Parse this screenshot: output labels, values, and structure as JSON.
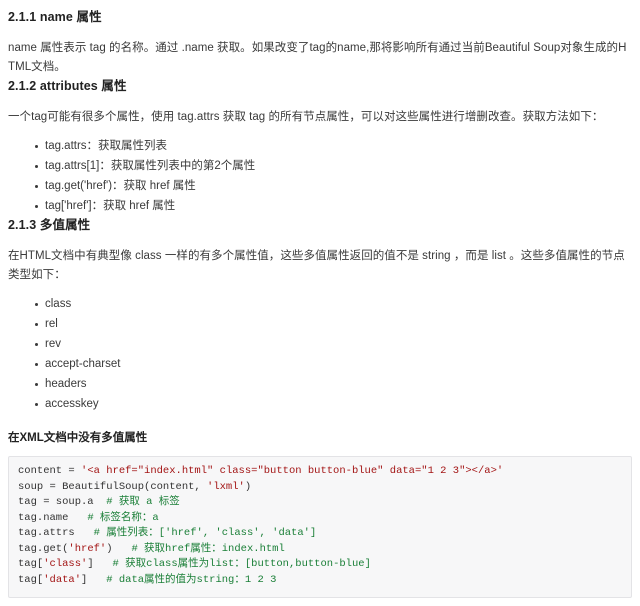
{
  "document": {
    "sections": [
      {
        "id": "2.1.1",
        "heading": "2.1.1 name 属性",
        "paragraph": "name 属性表示 tag 的名称。通过 .name 获取。如果改变了tag的name,那将影响所有通过当前Beautiful Soup对象生成的HTML文档。"
      },
      {
        "id": "2.1.2",
        "heading": "2.1.2 attributes 属性",
        "paragraph": "一个tag可能有很多个属性，使用 tag.attrs 获取 tag 的所有节点属性，可以对这些属性进行增删改查。获取方法如下：",
        "bullets": [
          "tag.attrs：获取属性列表",
          "tag.attrs[1]：获取属性列表中的第2个属性",
          "tag.get('href')：获取 href 属性",
          "tag['href']：获取 href 属性"
        ]
      },
      {
        "id": "2.1.3",
        "heading": "2.1.3 多值属性",
        "paragraph": "在HTML文档中有典型像 class 一样的有多个属性值，这些多值属性返回的值不是 string ，而是 list 。这些多值属性的节点类型如下：",
        "bullets": [
          "class",
          "rel",
          "rev",
          "accept-charset",
          "headers",
          "accesskey"
        ],
        "note": "在XML文档中没有多值属性"
      }
    ],
    "code_block": {
      "language": "python",
      "lines": [
        [
          {
            "t": "content = ",
            "k": "txt"
          },
          {
            "t": "'<a href=\"index.html\" class=\"button button-blue\" data=\"1 2 3\"></a>'",
            "k": "str"
          }
        ],
        [
          {
            "t": "soup = BeautifulSoup(content, ",
            "k": "txt"
          },
          {
            "t": "'lxml'",
            "k": "str"
          },
          {
            "t": ")",
            "k": "txt"
          }
        ],
        [
          {
            "t": "tag = soup.a  ",
            "k": "txt"
          },
          {
            "t": "# 获取 a 标签",
            "k": "com"
          }
        ],
        [
          {
            "t": "tag.name   ",
            "k": "txt"
          },
          {
            "t": "# 标签名称：a",
            "k": "com"
          }
        ],
        [
          {
            "t": "tag.attrs   ",
            "k": "txt"
          },
          {
            "t": "# 属性列表：['href', 'class', 'data']",
            "k": "com"
          }
        ],
        [
          {
            "t": "tag.get(",
            "k": "txt"
          },
          {
            "t": "'href'",
            "k": "str"
          },
          {
            "t": ")   ",
            "k": "txt"
          },
          {
            "t": "# 获取href属性：index.html",
            "k": "com"
          }
        ],
        [
          {
            "t": "tag[",
            "k": "txt"
          },
          {
            "t": "'class'",
            "k": "str"
          },
          {
            "t": "]   ",
            "k": "txt"
          },
          {
            "t": "# 获取class属性为list：[button,button-blue]",
            "k": "com"
          }
        ],
        [
          {
            "t": "tag[",
            "k": "txt"
          },
          {
            "t": "'data'",
            "k": "str"
          },
          {
            "t": "]   ",
            "k": "txt"
          },
          {
            "t": "# data属性的值为string：1 2 3",
            "k": "com"
          }
        ]
      ]
    },
    "colors": {
      "text": "#3a3a3a",
      "heading": "#222222",
      "code_background": "#f7f7f8",
      "code_border": "#e3e3e6",
      "string": "#a31515",
      "comment": "#1a7f37"
    }
  }
}
